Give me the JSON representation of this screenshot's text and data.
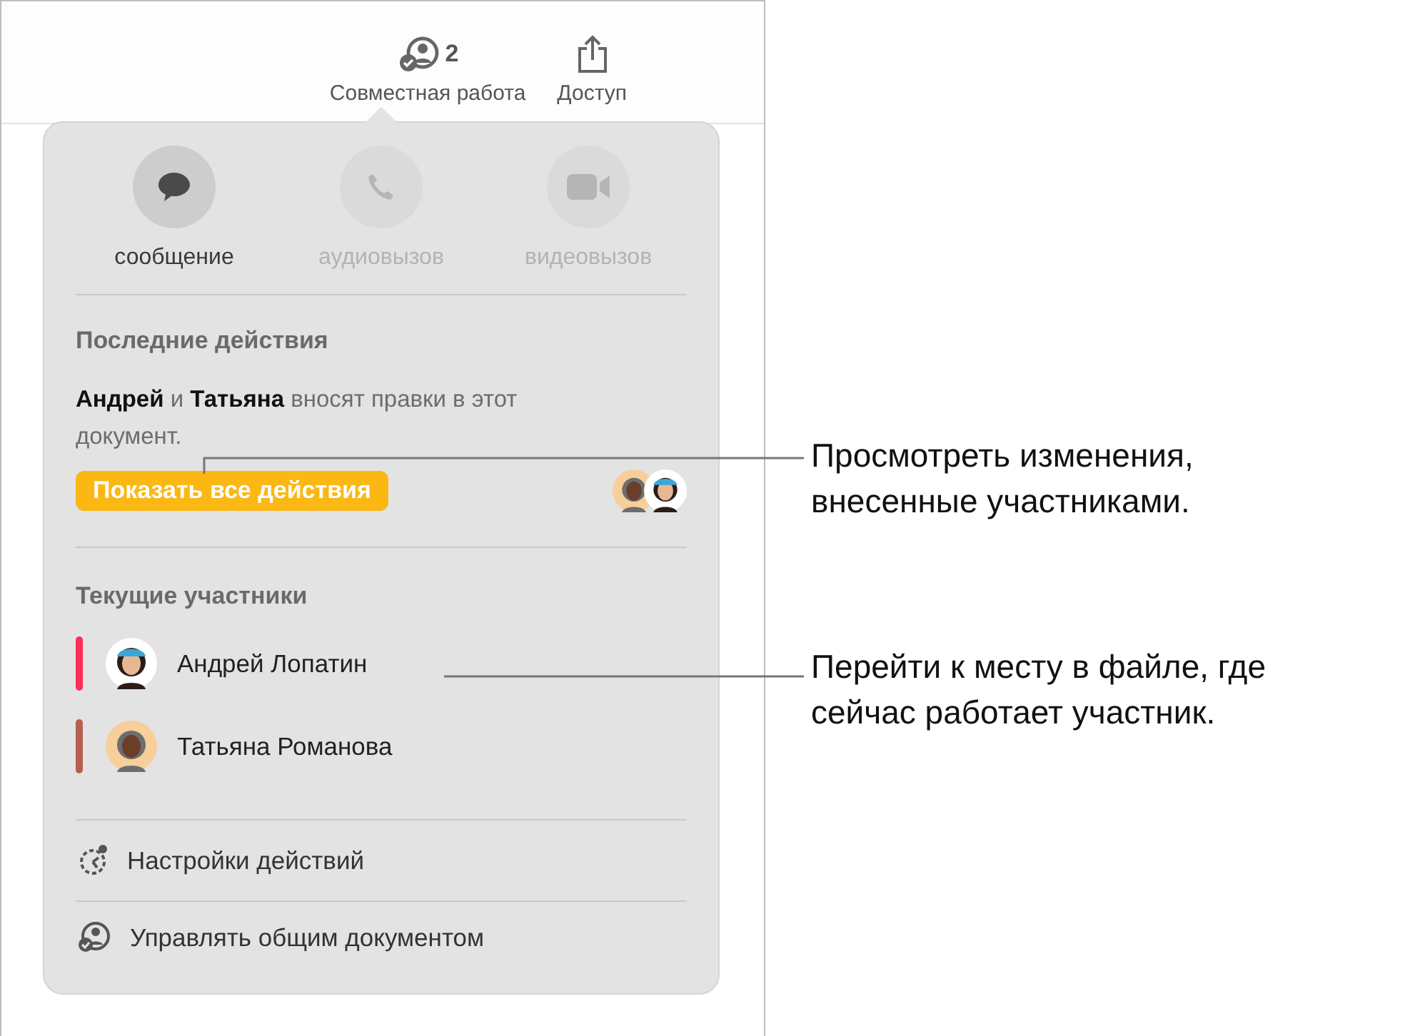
{
  "toolbar": {
    "collaborate": {
      "label": "Совместная работа",
      "count": "2"
    },
    "share": {
      "label": "Доступ"
    }
  },
  "popover": {
    "actions": [
      {
        "kind": "message",
        "label": "сообщение",
        "disabled": false
      },
      {
        "kind": "audio",
        "label": "аудиовызов",
        "disabled": true
      },
      {
        "kind": "video",
        "label": "видеовызов",
        "disabled": true
      }
    ],
    "recent": {
      "heading": "Последние действия",
      "text": "**Андрей** и **Татьяна** вносят правки в этот документ.",
      "button": "Показать все действия"
    },
    "current": {
      "heading": "Текущие участники",
      "participants": [
        {
          "name": "Андрей Лопатин",
          "color": "#ff2d55"
        },
        {
          "name": "Татьяна Романова",
          "color": "#b5604f"
        }
      ]
    },
    "menu": [
      {
        "kind": "settings",
        "label": "Настройки действий"
      },
      {
        "kind": "manage",
        "label": "Управлять общим документом"
      }
    ]
  },
  "callouts": [
    "Просмотреть изменения, внесенные участниками.",
    "Перейти к месту в файле, где сейчас работает участник."
  ]
}
